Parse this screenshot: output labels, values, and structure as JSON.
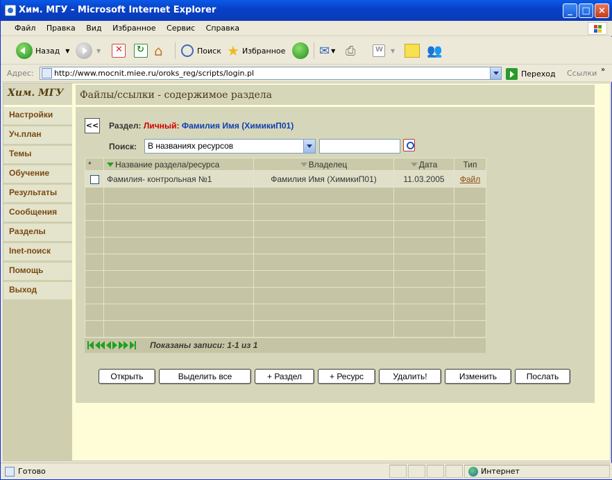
{
  "window": {
    "title": "Хим. МГУ - Microsoft Internet Explorer"
  },
  "menu": [
    "Файл",
    "Правка",
    "Вид",
    "Избранное",
    "Сервис",
    "Справка"
  ],
  "toolbar": {
    "back_label": "Назад",
    "search_label": "Поиск",
    "favorites_label": "Избранное"
  },
  "address": {
    "label": "Адрес:",
    "url": "http://www.mocnit.miee.ru/oroks_reg/scripts/login.pl",
    "go_label": "Переход",
    "links_label": "Ссылки"
  },
  "sidebar": {
    "title": "Хим. МГУ",
    "items": [
      "Настройки",
      "Уч.план",
      "Темы",
      "Обучение",
      "Результаты",
      "Сообщения",
      "Разделы",
      "Inet-поиск",
      "Помощь",
      "Выход"
    ]
  },
  "main": {
    "heading": "Файлы/ссылки - содержимое раздела",
    "back_label": "<<",
    "section_label": "Раздел:",
    "section_type": "Личный:",
    "section_owner": "Фамилия Имя (ХимикиП01)",
    "search_label": "Поиск:",
    "search_mode": "В названиях ресурсов",
    "search_value": ""
  },
  "table": {
    "headers": {
      "select": "*",
      "name": "Название раздела/ресурса",
      "owner": "Владелец",
      "date": "Дата",
      "type": "Тип"
    },
    "rows": [
      {
        "name": "Фамилия- контрольная №1",
        "owner": "Фамилия Имя (ХимикиП01)",
        "date": "11.03.2005",
        "type": "Файл"
      }
    ]
  },
  "pager": {
    "text": "Показаны записи: 1-1 из 1"
  },
  "buttons": {
    "open": "Открыть",
    "select_all": "Выделить все",
    "add_section": "+ Раздел",
    "add_resource": "+ Ресурс",
    "delete": "Удалить!",
    "edit": "Изменить",
    "send": "Послать"
  },
  "status": {
    "text": "Готово",
    "zone": "Интернет"
  }
}
